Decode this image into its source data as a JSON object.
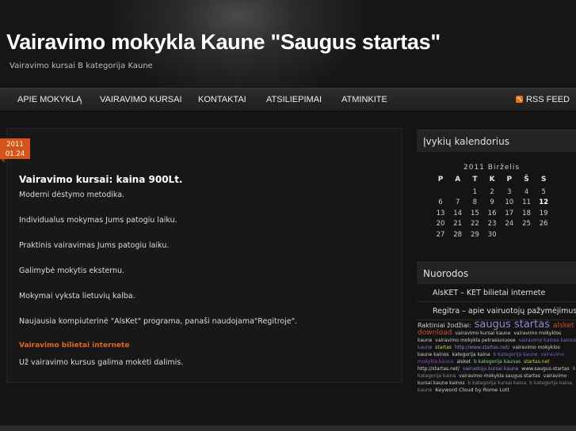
{
  "site": {
    "title": "Vairavimo mokykla Kaune \"Saugus startas\"",
    "subtitle": "Vairavimo kursai B kategorija Kaune"
  },
  "nav": {
    "items": [
      "APIE MOKYKLĄ",
      "VAIRAVIMO KURSAI",
      "KONTAKTAI",
      "ATSILIEPIMAI",
      "ATMINKITE"
    ],
    "rss_label": "RSS FEED"
  },
  "post": {
    "date_year": "2011",
    "date_day": "01.24",
    "title": "Vairavimo kursai: kaina 900Lt.",
    "lines": [
      "Moderni dėstymo metodika.",
      "Individualus mokymas Jums patogiu laiku.",
      "Praktinis vairavimas Jums patogiu laiku.",
      "Galimybė mokytis eksternu.",
      "Mokymai vyksta lietuvių kalba.",
      "Naujausia kompiuterinė \"AlsKet\" programa, panaši naudojama\"Regitroje\"."
    ],
    "link_text": "Vairavimo bilietai internete",
    "footer_line": "Už vairavimo kursus galima mokėti dalimis."
  },
  "calendar": {
    "heading": "Įvykių kalendorius",
    "caption": "2011 Birželis",
    "weekdays": [
      "P",
      "A",
      "T",
      "K",
      "P",
      "Š",
      "S"
    ],
    "weeks": [
      [
        "",
        "",
        "1",
        "2",
        "3",
        "4",
        "5"
      ],
      [
        "6",
        "7",
        "8",
        "9",
        "10",
        "11",
        "12"
      ],
      [
        "13",
        "14",
        "15",
        "16",
        "17",
        "18",
        "19"
      ],
      [
        "20",
        "21",
        "22",
        "23",
        "24",
        "25",
        "26"
      ],
      [
        "27",
        "28",
        "29",
        "30",
        "",
        "",
        ""
      ]
    ],
    "today": "12"
  },
  "links": {
    "heading": "Nuorodos",
    "items": [
      "AlsKET – KET bilietai internete",
      "Regitra – apie vairuotojų pažymėjimus"
    ]
  },
  "tags": {
    "label": "Raktiniai žodžiai:",
    "items": [
      {
        "text": "saugus startas",
        "color": "#8a8ad0",
        "size": 13
      },
      {
        "text": "alsket download",
        "color": "#d04a2a",
        "size": 9
      },
      {
        "text": "vairavimo kursai kaune",
        "color": "#cfcfcf",
        "size": 6
      },
      {
        "text": "vairavimo mokyklos kaune",
        "color": "#cfcfcf",
        "size": 6
      },
      {
        "text": "vairavimo mokykla petrasiunuose",
        "color": "#cfcfcf",
        "size": 6
      },
      {
        "text": "vairavimo kainos kainos kaune",
        "color": "#8a6ad0",
        "size": 6
      },
      {
        "text": "startas",
        "color": "#d0d04a",
        "size": 6
      },
      {
        "text": "http://www.startas.net/",
        "color": "#8a8ad0",
        "size": 6
      },
      {
        "text": "vairavimo mokyklos kaune kainos",
        "color": "#cfcfcf",
        "size": 6
      },
      {
        "text": "kategorija kaina",
        "color": "#cfcfcf",
        "size": 6
      },
      {
        "text": "b kategorija kaune",
        "color": "#6a6ad0",
        "size": 6
      },
      {
        "text": "vairavimo mokykla kaune",
        "color": "#8a4ad0",
        "size": 6
      },
      {
        "text": "alsket",
        "color": "#cfcfcf",
        "size": 6
      },
      {
        "text": "b kategorija kaunas",
        "color": "#8ad08a",
        "size": 6
      },
      {
        "text": "startas.net",
        "color": "#d0d04a",
        "size": 6
      },
      {
        "text": "http://startas.net/",
        "color": "#cfcfcf",
        "size": 6
      },
      {
        "text": "vairuotoju kursai kaune",
        "color": "#8a8ad0",
        "size": 6
      },
      {
        "text": "www.saugus-startas",
        "color": "#cfcfcf",
        "size": 6
      },
      {
        "text": "b kategorija kaina",
        "color": "#8a8a8a",
        "size": 6
      },
      {
        "text": "vairavimo mokykla saugus startas",
        "color": "#cfcfcf",
        "size": 6
      },
      {
        "text": "vairavimo kursai kaune kainos",
        "color": "#cfcfcf",
        "size": 6
      },
      {
        "text": "b kategorija kursai kaina",
        "color": "#8a8a8a",
        "size": 6
      },
      {
        "text": "b kategorija kaina kaune",
        "color": "#8a8a8a",
        "size": 6
      }
    ],
    "credit": "Keyword Cloud by Rome Lott"
  },
  "colors": {
    "accent": "#d4541a",
    "link": "#e6641f",
    "background": "#141414"
  }
}
